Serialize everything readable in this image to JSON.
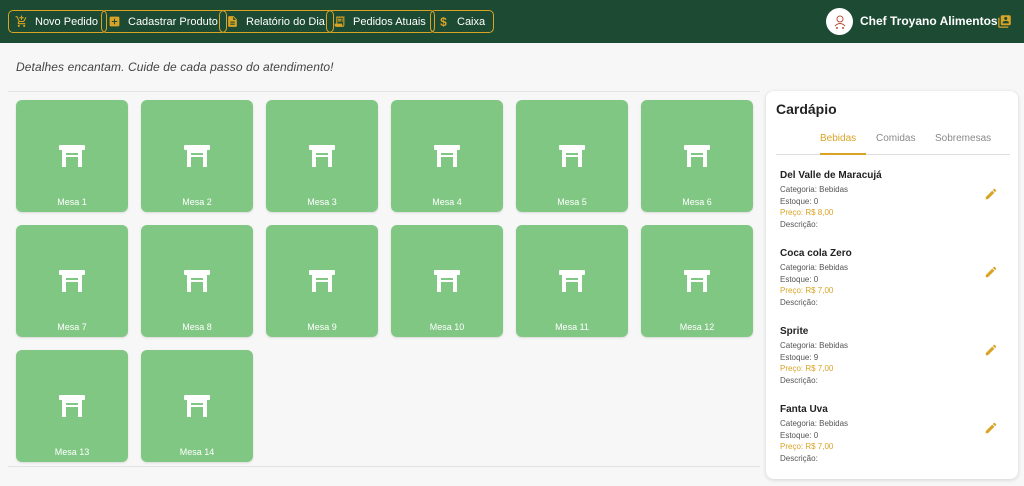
{
  "topbar": {
    "buttons": [
      {
        "label": "Novo Pedido",
        "icon": "cart-plus-icon"
      },
      {
        "label": "Cadastrar Produto",
        "icon": "add-box-icon"
      },
      {
        "label": "Relatório do Dia",
        "icon": "document-icon"
      },
      {
        "label": "Pedidos Atuais",
        "icon": "receipt-icon"
      },
      {
        "label": "Caixa",
        "icon": "dollar-icon"
      }
    ],
    "brand_name": "Chef Troyano Alimentos",
    "accent_color": "#d9a426",
    "bar_color": "#1d4a33"
  },
  "slogan": "Detalhes encantam. Cuide de cada passo do atendimento!",
  "tables": [
    {
      "label": "Mesa 1"
    },
    {
      "label": "Mesa 2"
    },
    {
      "label": "Mesa 3"
    },
    {
      "label": "Mesa 4"
    },
    {
      "label": "Mesa 5"
    },
    {
      "label": "Mesa 6"
    },
    {
      "label": "Mesa 7"
    },
    {
      "label": "Mesa 8"
    },
    {
      "label": "Mesa 9"
    },
    {
      "label": "Mesa 10"
    },
    {
      "label": "Mesa 11"
    },
    {
      "label": "Mesa 12"
    },
    {
      "label": "Mesa 13"
    },
    {
      "label": "Mesa 14"
    }
  ],
  "table_color": "#81c784",
  "menu": {
    "title": "Cardápio",
    "tabs": [
      {
        "label": "Bebidas",
        "active": true
      },
      {
        "label": "Comidas",
        "active": false
      },
      {
        "label": "Sobremesas",
        "active": false
      }
    ],
    "products": [
      {
        "name": "Del Valle de Maracujá",
        "category": "Categoria: Bebidas",
        "stock": "Estoque: 0",
        "price": "Preço: R$ 8,00",
        "description": "Descrição:"
      },
      {
        "name": "Coca cola Zero",
        "category": "Categoria: Bebidas",
        "stock": "Estoque: 0",
        "price": "Preço: R$ 7,00",
        "description": "Descrição:"
      },
      {
        "name": "Sprite",
        "category": "Categoria: Bebidas",
        "stock": "Estoque: 9",
        "price": "Preço: R$ 7,00",
        "description": "Descrição:"
      },
      {
        "name": "Fanta Uva",
        "category": "Categoria: Bebidas",
        "stock": "Estoque: 0",
        "price": "Preço: R$ 7,00",
        "description": "Descrição:"
      }
    ]
  }
}
